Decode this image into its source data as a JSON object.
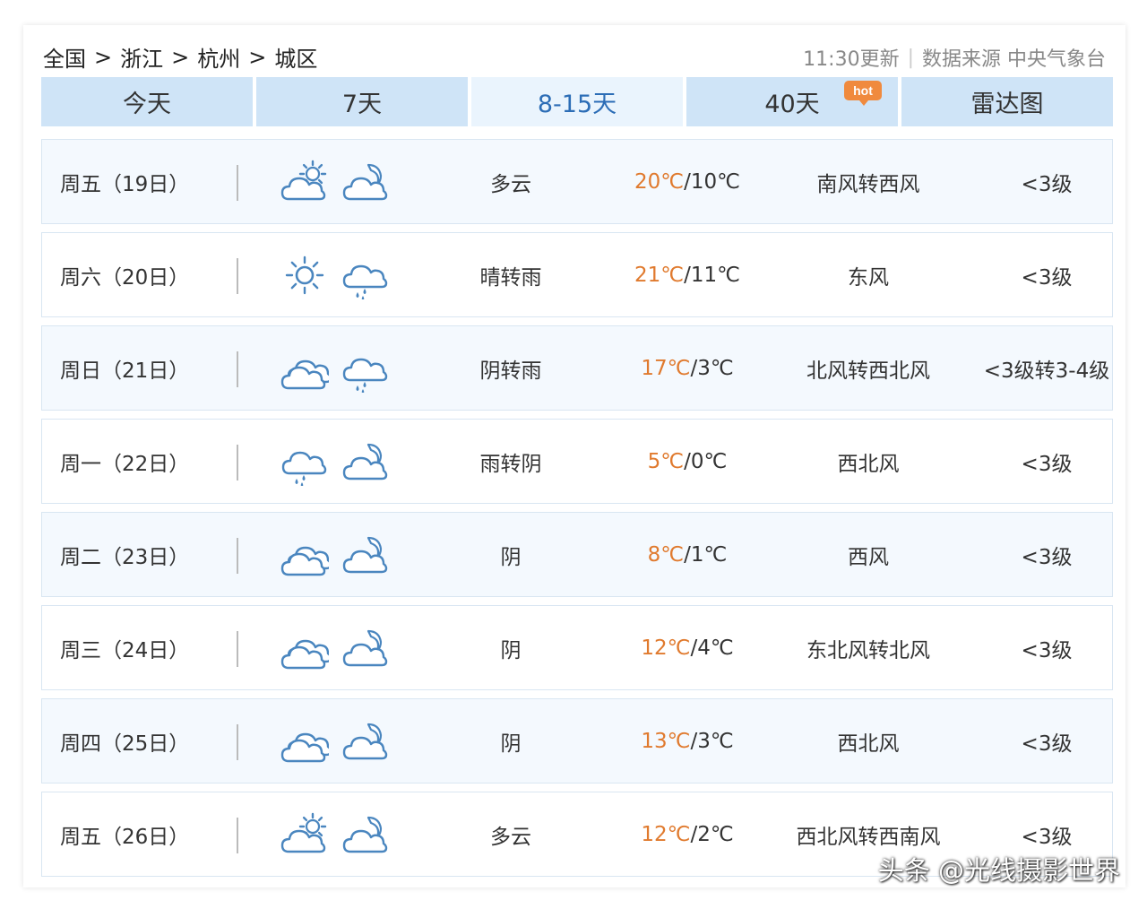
{
  "breadcrumb": {
    "items": [
      "全国",
      "浙江",
      "杭州",
      "城区"
    ],
    "separator": ">"
  },
  "update_time": "11:30更新",
  "source_divider": "|",
  "source_text": "数据来源 中央气象台",
  "tabs": [
    {
      "label": "今天",
      "active": false
    },
    {
      "label": "7天",
      "active": false
    },
    {
      "label": "8-15天",
      "active": true
    },
    {
      "label": "40天",
      "active": false
    },
    {
      "label": "雷达图",
      "active": false
    }
  ],
  "hot_badge": "hot",
  "temp_separator": "/",
  "days": [
    {
      "date": "周五（19日）",
      "icons": [
        "partly-cloudy-day-icon",
        "cloudy-night-icon"
      ],
      "desc": "多云",
      "high": "20℃",
      "low": "10℃",
      "wind": "南风转西风",
      "level": "<3级"
    },
    {
      "date": "周六（20日）",
      "icons": [
        "sunny-icon",
        "rain-icon"
      ],
      "desc": "晴转雨",
      "high": "21℃",
      "low": "11℃",
      "wind": "东风",
      "level": "<3级"
    },
    {
      "date": "周日（21日）",
      "icons": [
        "overcast-icon",
        "rain-icon"
      ],
      "desc": "阴转雨",
      "high": "17℃",
      "low": "3℃",
      "wind": "北风转西北风",
      "level": "<3级转3-4级"
    },
    {
      "date": "周一（22日）",
      "icons": [
        "rain-icon",
        "cloudy-night-icon"
      ],
      "desc": "雨转阴",
      "high": "5℃",
      "low": "0℃",
      "wind": "西北风",
      "level": "<3级"
    },
    {
      "date": "周二（23日）",
      "icons": [
        "overcast-icon",
        "cloudy-night-icon"
      ],
      "desc": "阴",
      "high": "8℃",
      "low": "1℃",
      "wind": "西风",
      "level": "<3级"
    },
    {
      "date": "周三（24日）",
      "icons": [
        "overcast-icon",
        "cloudy-night-icon"
      ],
      "desc": "阴",
      "high": "12℃",
      "low": "4℃",
      "wind": "东北风转北风",
      "level": "<3级"
    },
    {
      "date": "周四（25日）",
      "icons": [
        "overcast-icon",
        "cloudy-night-icon"
      ],
      "desc": "阴",
      "high": "13℃",
      "low": "3℃",
      "wind": "西北风",
      "level": "<3级"
    },
    {
      "date": "周五（26日）",
      "icons": [
        "partly-cloudy-day-icon",
        "cloudy-night-icon"
      ],
      "desc": "多云",
      "high": "12℃",
      "low": "2℃",
      "wind": "西北风转西南风",
      "level": "<3级"
    }
  ],
  "watermark": "头条 @光线摄影世界",
  "colors": {
    "tab_bg": "#cfe4f7",
    "tab_active_bg": "#eaf4fd",
    "tab_active_text": "#2c6db6",
    "high_temp": "#e07a2e",
    "icon_stroke": "#4a86bf",
    "hot_badge": "#f08a3e"
  }
}
